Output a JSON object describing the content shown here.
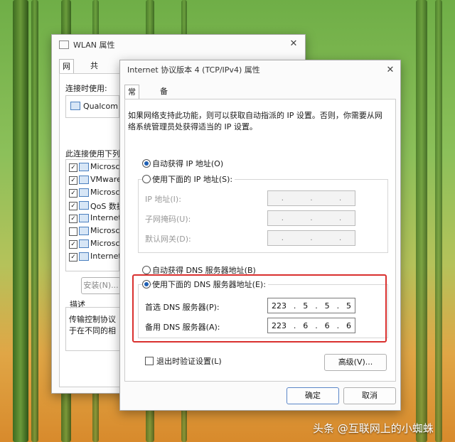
{
  "wlan": {
    "title": "WLAN 属性",
    "tabs": [
      "网络",
      "共享"
    ],
    "connect_using_label": "连接时使用:",
    "adapter_name": "Qualcom",
    "items_label": "此连接使用下列项",
    "items": [
      {
        "label": "Microsc",
        "checked": true
      },
      {
        "label": "VMware",
        "checked": true
      },
      {
        "label": "Microsc",
        "checked": true
      },
      {
        "label": "QoS 数据",
        "checked": true
      },
      {
        "label": "Internet",
        "checked": true
      },
      {
        "label": "Microsc",
        "checked": false
      },
      {
        "label": "Microsc",
        "checked": true
      },
      {
        "label": "Internet",
        "checked": true
      }
    ],
    "install_label": "安装(N)...",
    "desc_label": "描述",
    "desc_line1": "传输控制协议",
    "desc_line2": "于在不同的相"
  },
  "ipv4": {
    "title": "Internet 协议版本 4 (TCP/IPv4) 属性",
    "tabs": [
      "常规",
      "备用配置"
    ],
    "intro_line1": "如果网络支持此功能，则可以获取自动指派的 IP 设置。否则，你需要从网",
    "intro_line2": "络系统管理员处获得适当的 IP 设置。",
    "auto_ip": "自动获得 IP 地址(O)",
    "manual_ip": "使用下面的 IP 地址(S):",
    "ip_address": "IP 地址(I):",
    "subnet": "子网掩码(U):",
    "gateway": "默认网关(D):",
    "auto_dns": "自动获得 DNS 服务器地址(B)",
    "manual_dns": "使用下面的 DNS 服务器地址(E):",
    "preferred_dns_label": "首选 DNS 服务器(P):",
    "alternate_dns_label": "备用 DNS 服务器(A):",
    "preferred_dns": [
      "223",
      "5",
      "5",
      "5"
    ],
    "alternate_dns": [
      "223",
      "6",
      "6",
      "6"
    ],
    "validate_label": "退出时验证设置(L)",
    "advanced_label": "高级(V)...",
    "ok_label": "确定",
    "cancel_label": "取消"
  },
  "watermark": "头条 @互联网上的小蜘蛛"
}
